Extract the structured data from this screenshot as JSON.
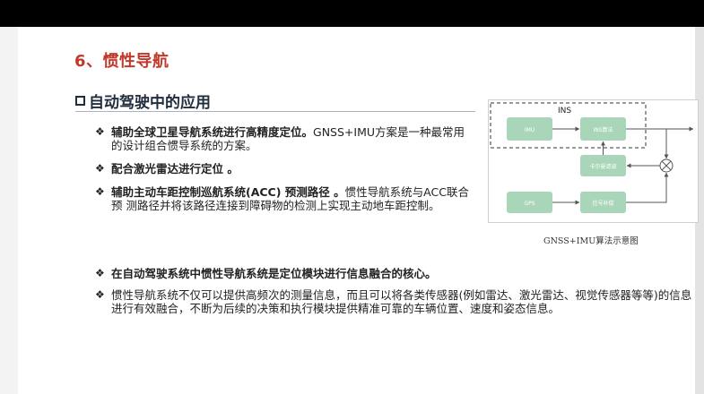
{
  "slide": {
    "title": "6、惯性导航",
    "section": "自动驾驶中的应用"
  },
  "bullets": [
    {
      "strong": "辅助全球卫星导航系统进行高精度定位。",
      "rest": "GNSS+IMU方案是一种最常用的设计组合惯导系统的方案。"
    },
    {
      "strong": "配合激光雷达进行定位 。",
      "rest": ""
    },
    {
      "strong": "辅助主动车距控制巡航系统(ACC) 预测路径 。",
      "rest": "惯性导航系统与ACC联合预 测路径并将该路径连接到障碍物的检测上实现主动地车距控制。"
    }
  ],
  "bullets2": [
    {
      "strong": "在自动驾驶系统中惯性导航系统是定位模块进行信息融合的核心。",
      "rest": ""
    },
    {
      "strong": "",
      "rest": "惯性导航系统不仅可以提供高频次的测量信息，而且可以将各类传感器(例如雷达、激光雷达、视觉传感器等等)的信息进行有效融合，不断为后续的决策和执行模块提供精准可靠的车辆位置、速度和姿态信息。"
    }
  ],
  "figure": {
    "ins_label": "INS",
    "blocks": {
      "imu": "IMU",
      "ins_algo": "INS算法",
      "kalman": "卡尔曼滤波",
      "gps": "GPS",
      "signal": "信号补偿"
    },
    "caption": "GNSS+IMU算法示意图",
    "block_color": "#a9d6b8"
  },
  "icons": {
    "bullet": "diamond-bullet-icon",
    "section": "checkbox-icon",
    "mixer": "cross-circle-icon"
  }
}
